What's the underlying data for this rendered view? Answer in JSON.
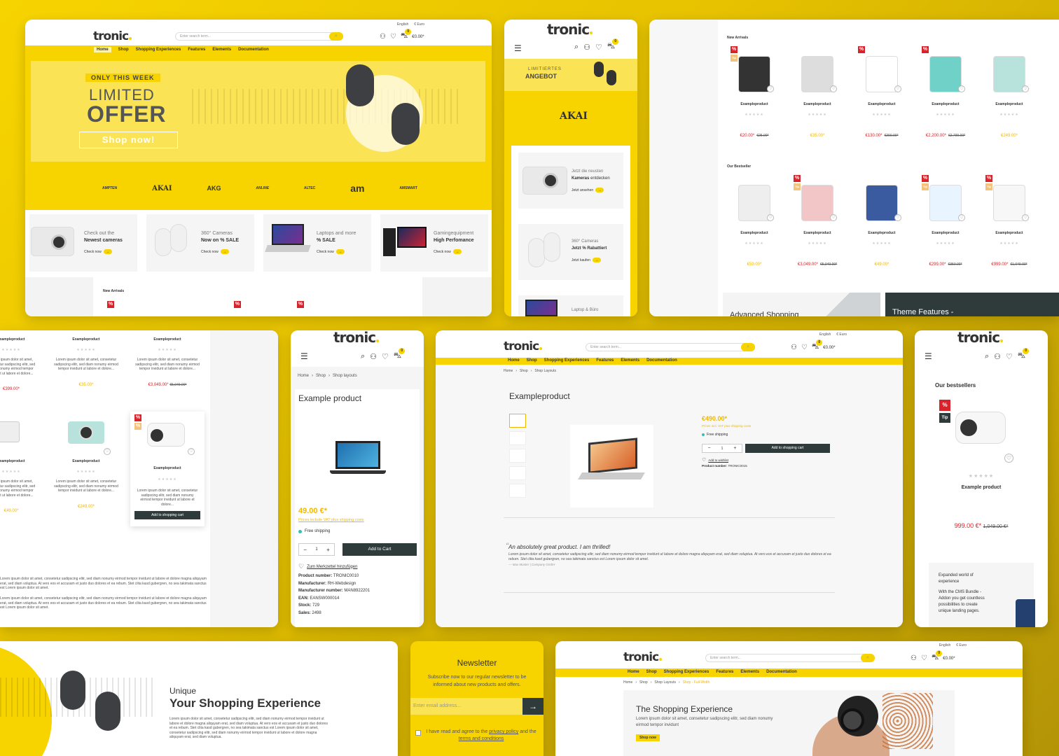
{
  "brand": "tronic",
  "lang": "English",
  "currency": "€ Euro",
  "search_placeholder": "Enter search term...",
  "cart_total": "€0.00*",
  "cart_count": "0",
  "nav": [
    "Home",
    "Shop",
    "Shopping Experiences",
    "Features",
    "Elements",
    "Documentation"
  ],
  "hero": {
    "kicker": "ONLY THIS WEEK",
    "line1": "LIMITED",
    "line2": "OFFER",
    "cta": "Shop now!"
  },
  "brands": [
    "AMPTEN",
    "AKAI",
    "AKG",
    "ANLINE",
    "ALTEC",
    "am",
    "AMSMART"
  ],
  "promo_tiles": [
    {
      "small": "Check out the",
      "big": "Newest cameras",
      "link": "Check now"
    },
    {
      "small": "360° Cameras",
      "big": "Now on % SALE",
      "link": "Check now"
    },
    {
      "small": "Laptops and more",
      "big": "% SALE",
      "link": "Check now"
    },
    {
      "small": "Gamingequipment",
      "big": "High Perfomance",
      "link": "Check now"
    }
  ],
  "new_arrivals": "New Arrivals",
  "our_bestseller": "Our Bestseller",
  "example_product": "Exampleproduct",
  "mobile_promo": {
    "banner_small": "LIMITIERTES",
    "banner_big": "ANGEBOT",
    "akai": "AKAI",
    "t1_small": "Jetzt die neusten",
    "t1_big": "Kameras",
    "t1_rest": "entdecken",
    "t1_link": "Jetzt ansehen",
    "t2_small": "360° Cameras",
    "t2_big": "Jetzt % Rabattiert",
    "t2_link": "Jetzt kaufen",
    "t3_small": "Laptop & Büro"
  },
  "grid_prices": {
    "arrivals": [
      [
        "€20.00*",
        "€25.00*"
      ],
      [
        "€35.00*",
        ""
      ],
      [
        "€130.00*",
        "€200.00*"
      ],
      [
        "€2,200.00*",
        "€2,799.00*"
      ],
      [
        "€249.00*",
        ""
      ]
    ],
    "bestseller": [
      [
        "€59.00*",
        ""
      ],
      [
        "€3,049.00*",
        "€5,049.00*"
      ],
      [
        "€49.00*",
        ""
      ],
      [
        "€299.00*",
        "€350.00*"
      ],
      [
        "€999.00*",
        "€1,049.00*"
      ]
    ]
  },
  "bottom_banners": [
    "Advanced Shopping",
    "Theme Features -"
  ],
  "listing": {
    "lorem": "Lorem ipsum dolor sit amet, consetetur sadipscing elitr, sed diam nonumy eirmod tempor invidunt ut labore et dolore...",
    "row1_prices": [
      [
        "€399.00*",
        ""
      ],
      [
        "€35.00*",
        ""
      ],
      [
        "€3,049.00*",
        "€5,049.00*"
      ]
    ],
    "row2_prices": [
      [
        "€49.00*",
        ""
      ],
      [
        "€249.00*",
        ""
      ],
      [
        "",
        ""
      ]
    ],
    "add_to_cart": "Add to shopping cart",
    "long_lorem": "Lorem ipsum dolor sit amet, consetetur sadipscing elitr, sed diam nonumy eirmod tempor invidunt ut labore et dolore magna aliquyam erat, sed diam voluptua. At vero eos et accusam et justo duo dolores et ea rebum. Stet clita kasd gubergren, no sea takimata sanctus est Lorem ipsum dolor sit amet."
  },
  "mobile_pdp": {
    "breadcrumb": [
      "Home",
      "Shop",
      "Shop layouts"
    ],
    "title": "Example product",
    "price": "49.00 €*",
    "vat": "Prices include VAT plus shipping costs",
    "shipping": "Free shipping",
    "qty": "1",
    "add": "Add to Cart",
    "wishlist": "Zum Merkzettel hinzufügen",
    "specs": [
      {
        "k": "Product number:",
        "v": "TRONIC0010"
      },
      {
        "k": "Manufacturer:",
        "v": "RH-Webdesign"
      },
      {
        "k": "Manufacturer number:",
        "v": "MAN8922201"
      },
      {
        "k": "EAN:",
        "v": "EANSW000014"
      },
      {
        "k": "Stock:",
        "v": "729"
      },
      {
        "k": "Sales:",
        "v": "2498"
      }
    ]
  },
  "desktop_pdp": {
    "breadcrumb": [
      "Home",
      "Shop",
      "Shop Layouts"
    ],
    "title": "Exampleproduct",
    "price": "€490.00*",
    "vat": "Prices incl. VAT plus shipping costs",
    "shipping": "Free shipping",
    "qty": "1",
    "add": "Add to shopping cart",
    "wishlist": "Add to wishlist",
    "prodnum": "Product number:",
    "prodnum_val": "TRONIC0015",
    "quote": "An absolutely great product. I am thrilled!",
    "quote_body": "Lorem ipsum dolor sit amet, consetetur sadipscing elitr, sed diam nonumy eirmod tempor invidunt ut labore et dolore magna aliquyam erat, sed diam voluptua. At vero eos et accusam et justo duo dolores et ea rebum. Stet clita kasd gubergren, no sea takimata sanctus est Lorem ipsum dolor sit amet.",
    "quote_author": "— Max Muster | Company GmbH"
  },
  "mobile_best": {
    "title": "Our bestsellers",
    "badge": "%",
    "tip": "Tip",
    "name": "Example product",
    "price": "999.00 €*",
    "old": "1,049.00 €*",
    "cms_text1": "Expanded world of experience",
    "cms_text2": "With the CMS Bundle - Addon you get countless possibilities to create unique landing pages."
  },
  "unique": {
    "small": "Unique",
    "big": "Your Shopping Experience",
    "body": "Lorem ipsum dolor sit amet, consetetur sadipscing elitr, sed diam nonumy eirmod tempor invidunt ut labore et dolore magna aliquyam erat, sed diam voluptua. At vero eos et accusam et justo duo dolores et ea rebum. Stet clita kasd gubergren, no sea takimata sanctus est Lorem ipsum dolor sit amet, consetetur sadipscing elitr, sed diam nonumy eirmod tempor invidunt ut labore et dolore magna aliquyam erat, sed diam voluptua."
  },
  "newsletter": {
    "title": "Newsletter",
    "text": "Subscribe now to our regular newsletter to be informed about new products and offers.",
    "placeholder": "Enter email address...",
    "agree1": "I have read and agree to the",
    "privacy": "privacy policy",
    "and": "and",
    "agree2": "the",
    "terms": "terms and conditions"
  },
  "fullwidth": {
    "breadcrumb": [
      "Home",
      "Shop",
      "Shop Layouts",
      "Shop - Full-Width"
    ],
    "title": "The Shopping Experience",
    "body": "Lorem ipsum dolor sit amet, consetetur sadipscing elitr, sed diam nonumy eirmod tempor invidunt",
    "cta": "Shop now"
  }
}
